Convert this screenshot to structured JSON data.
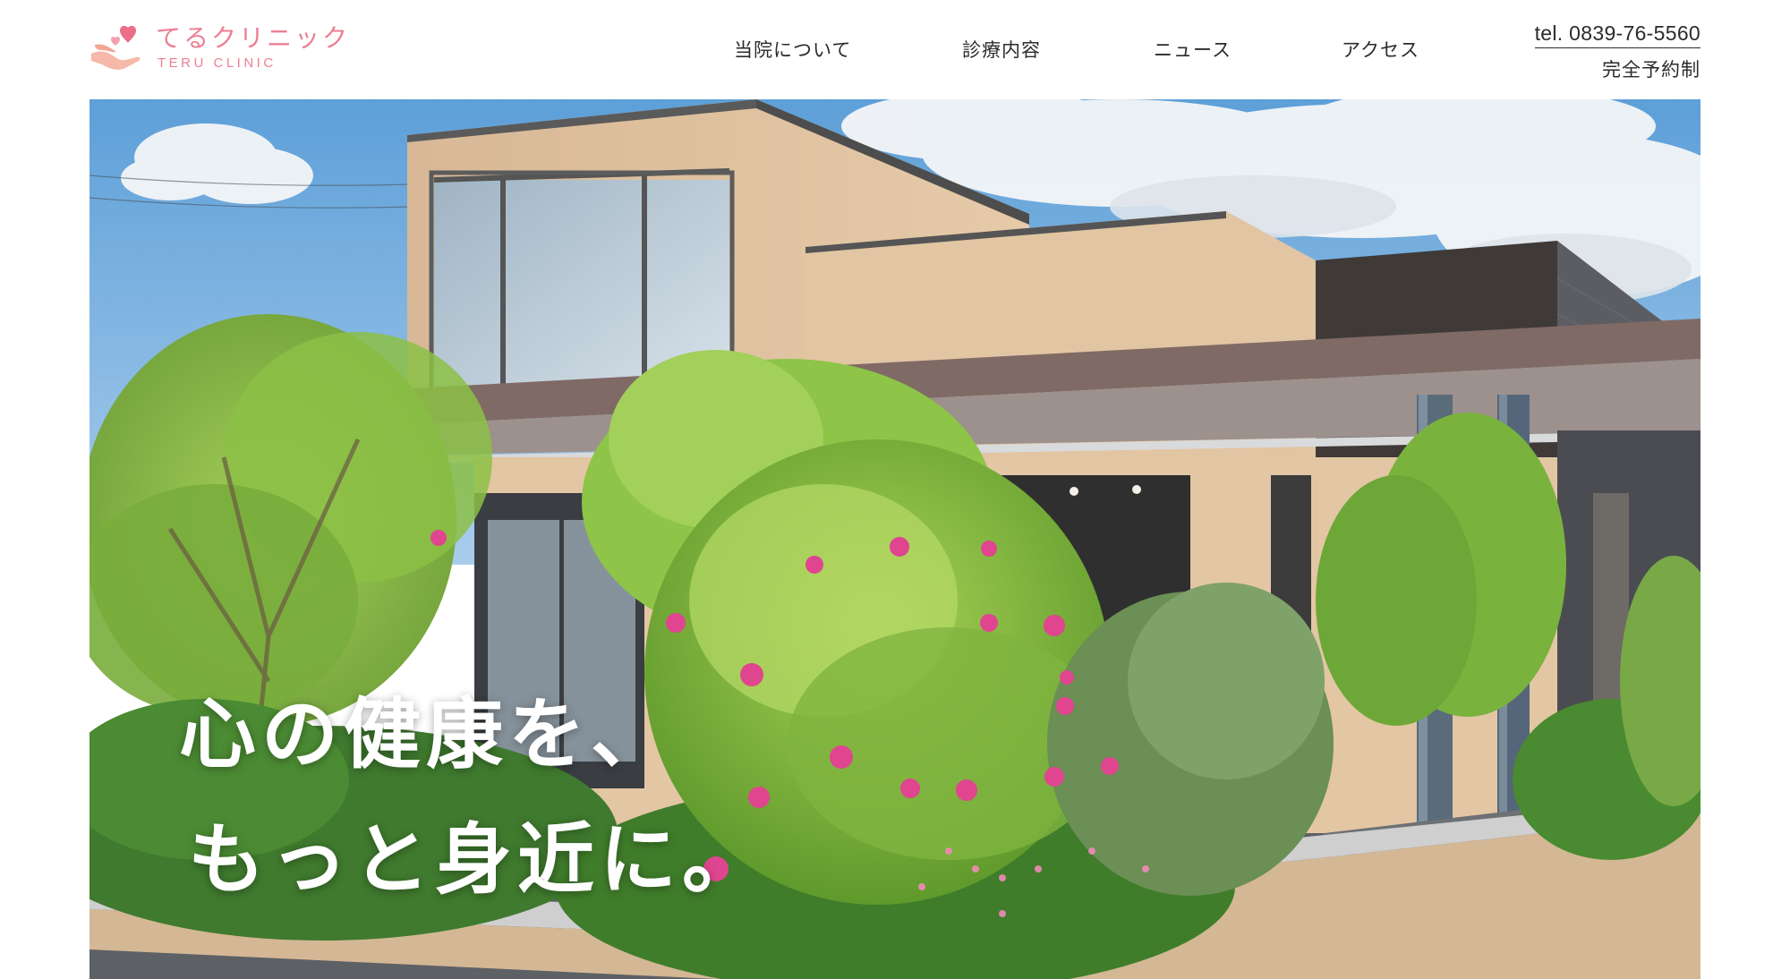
{
  "header": {
    "logo": {
      "name_ja": "てるクリニック",
      "name_en": "TERU CLINIC",
      "icon": "heart-hands-logo"
    },
    "nav": [
      {
        "label": "当院について"
      },
      {
        "label": "診療内容"
      },
      {
        "label": "ニュース"
      },
      {
        "label": "アクセス"
      }
    ],
    "contact": {
      "tel": "tel. 0839-76-5560",
      "note": "完全予約制"
    }
  },
  "hero": {
    "image": "clinic-building-exterior-photo",
    "lines": [
      "心の健康を、",
      "もっと身近に。"
    ]
  },
  "colors": {
    "brand": "#ec7f93",
    "text": "#2b2b2b",
    "background": "#ffffff",
    "hero_text": "#ffffff"
  }
}
